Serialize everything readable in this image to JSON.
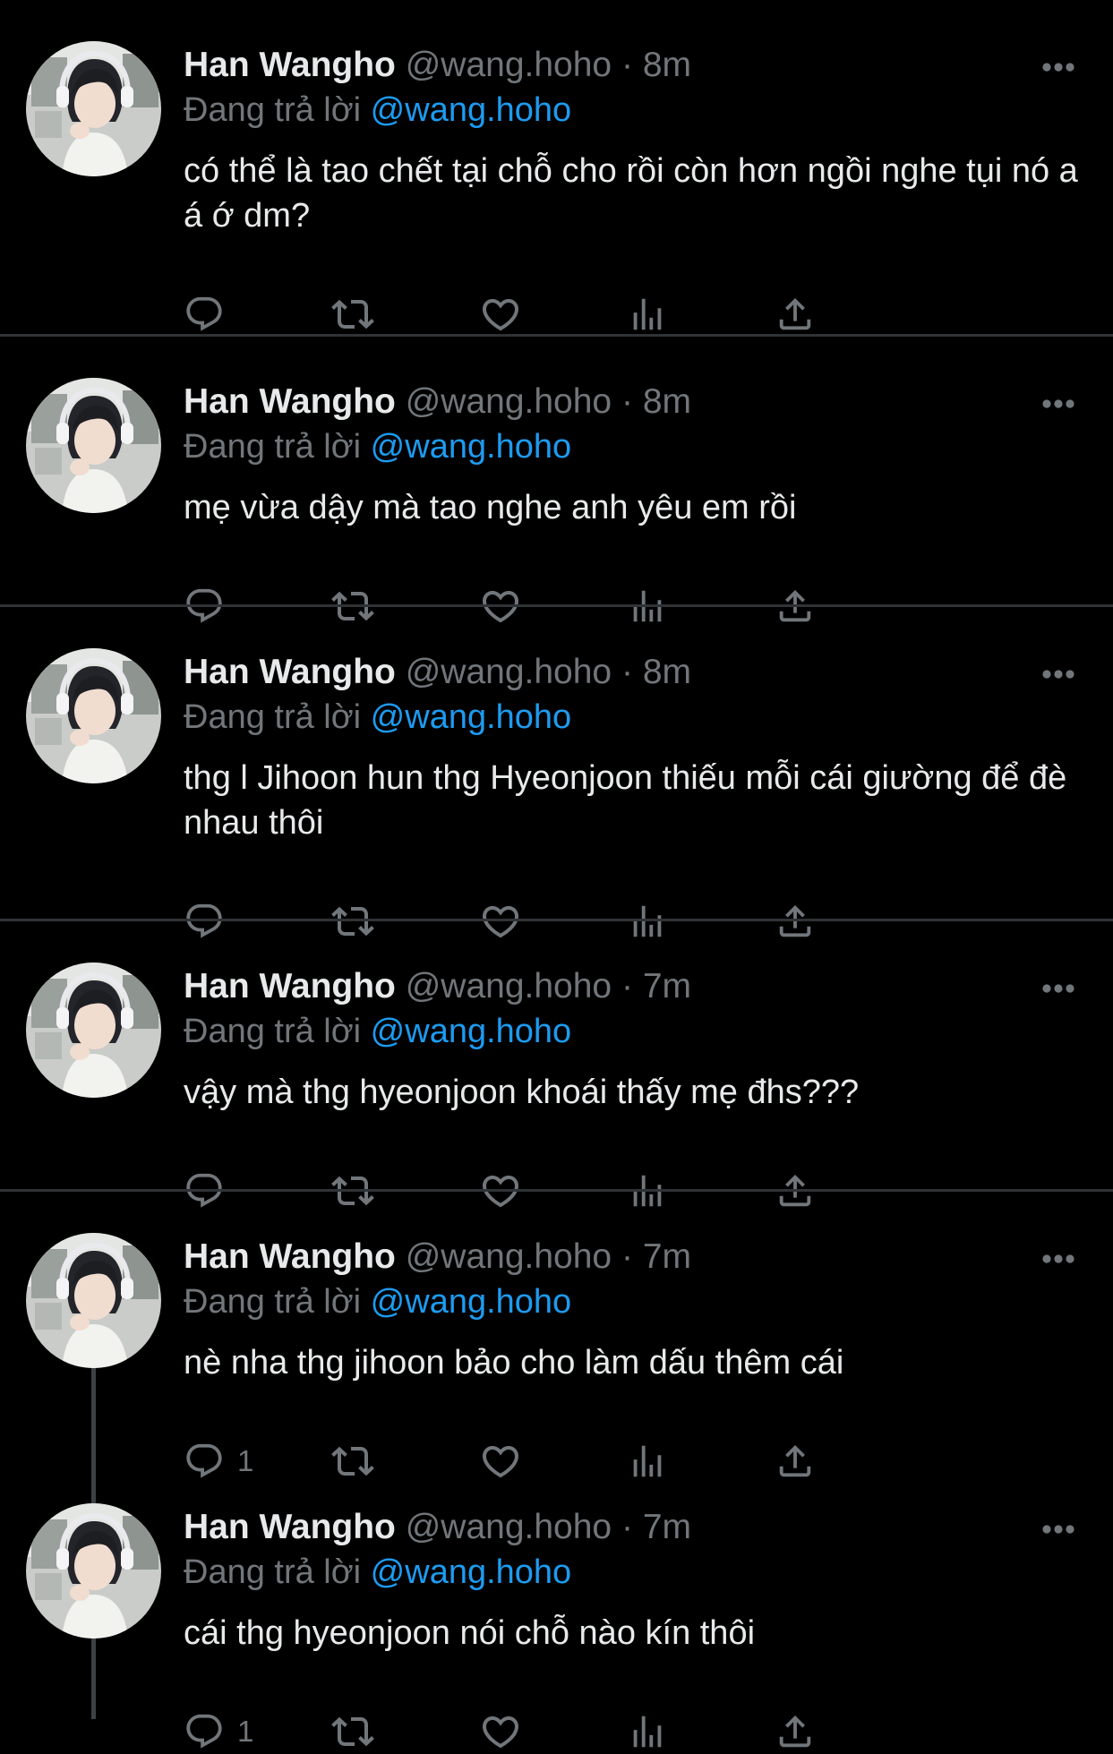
{
  "author": {
    "name": "Han Wangho",
    "handle": "@wang.hoho",
    "separator": "·"
  },
  "reply_prefix": "Đang trả lời",
  "reply_to": "@wang.hoho",
  "colors": {
    "background": "#000000",
    "text": "#e7e9ea",
    "secondary": "#71767b",
    "link": "#1d9bf0",
    "divider": "#2f3336"
  },
  "icons": [
    "more-icon",
    "reply-icon",
    "retweet-icon",
    "like-icon",
    "views-icon",
    "share-icon"
  ],
  "tweets": [
    {
      "time": "8m",
      "text": "có thể là tao chết tại chỗ cho rồi còn hơn ngồi nghe tụi nó a á ớ dm?",
      "reply_count": ""
    },
    {
      "time": "8m",
      "text": "mẹ vừa dậy mà tao nghe anh yêu em rồi",
      "reply_count": ""
    },
    {
      "time": "8m",
      "text": "thg l Jihoon hun thg Hyeonjoon thiếu mỗi cái giường để đè nhau thôi",
      "reply_count": ""
    },
    {
      "time": "7m",
      "text": "vậy mà thg hyeonjoon khoái thấy mẹ đhs???",
      "reply_count": ""
    },
    {
      "time": "7m",
      "text": "nè nha thg jihoon bảo cho làm dấu thêm cái",
      "reply_count": "1"
    },
    {
      "time": "7m",
      "text": "cái thg hyeonjoon nói chỗ nào kín thôi",
      "reply_count": "1"
    }
  ]
}
